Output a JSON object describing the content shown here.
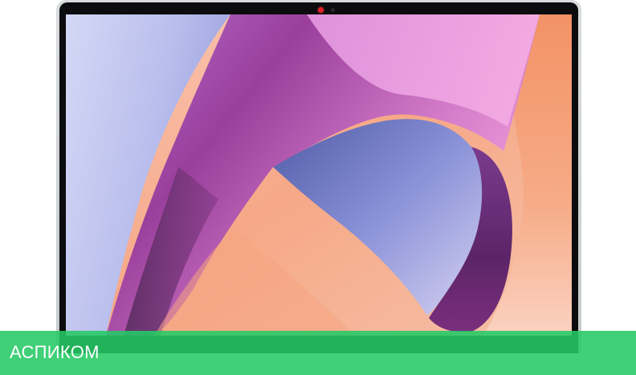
{
  "watermark": {
    "text": "АСПИКОМ",
    "background_color": "#24c965",
    "text_color": "#ffffff"
  },
  "device": {
    "camera_led_color": "#e0202a",
    "bezel_color": "#0c0c0e",
    "shell_color": "#d4d7d7"
  },
  "wallpaper": {
    "colors": [
      "#c8cdf4",
      "#5a2d6a",
      "#b84aa6",
      "#f4a4e0",
      "#f59a6a",
      "#f9c6b2",
      "#6f78c6"
    ]
  }
}
